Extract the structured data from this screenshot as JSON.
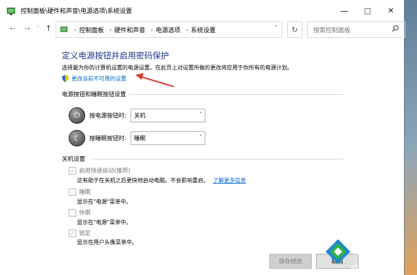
{
  "window": {
    "title": "控制面板\\硬件和声音\\电源选项\\系统设置",
    "controls": {
      "minimize": "—",
      "maximize": "□",
      "close": "✕"
    }
  },
  "address": {
    "crumbs": [
      "控制面板",
      "硬件和声音",
      "电源选项",
      "系统设置"
    ],
    "search_placeholder": "搜索控制面板"
  },
  "content": {
    "heading": "定义电源按钮并启用密码保护",
    "description": "选择最为你的计算机设置的电源设置。在此页上对设置所做的更改将应用于你所有的电源计划。",
    "change_link": "更改当前不可用的设置"
  },
  "power_section": {
    "title": "电源按钮和睡眠按钮设置",
    "rows": [
      {
        "label": "按电源按钮时:",
        "value": "关机"
      },
      {
        "label": "按睡眠按钮时:",
        "value": "睡眠"
      }
    ]
  },
  "shutdown_section": {
    "title": "关机设置",
    "options": [
      {
        "label": "启用快速启动(推荐)",
        "checked": true,
        "desc": "这有助于在关机之后更快地启动电脑。不会影响重启。",
        "link": "了解更多信息"
      },
      {
        "label": "睡眠",
        "checked": false,
        "desc": "显示在\"电源\"菜单中。"
      },
      {
        "label": "休眠",
        "checked": false,
        "desc": "显示在\"电源\"菜单中。"
      },
      {
        "label": "锁定",
        "checked": true,
        "desc": "显示在用户头像菜单中。"
      }
    ]
  },
  "buttons": {
    "save": "保存修改",
    "cancel": "取消"
  },
  "watermark": {
    "brand": "系统城",
    "url": "xitongcheng.com"
  },
  "colors": {
    "heading": "#1e3287",
    "link": "#0066cc",
    "arrow": "#e23b2e"
  }
}
